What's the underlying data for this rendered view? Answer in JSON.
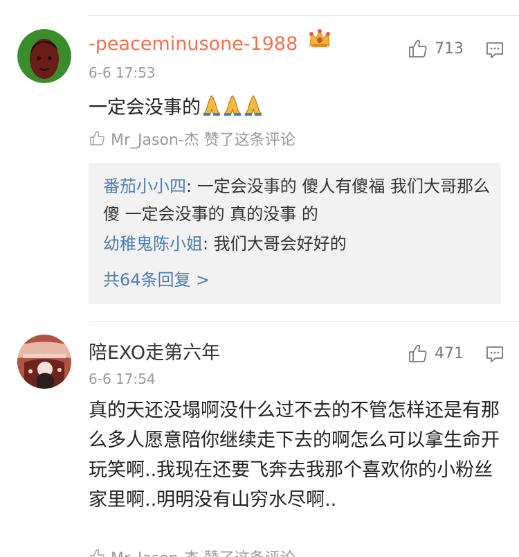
{
  "comments": [
    {
      "username": "-peaceminusone-1988",
      "time": "6-6 17:53",
      "likes": "713",
      "text": "一定会没事的",
      "liked_by": "Mr_Jason-杰 赞了这条评论",
      "replies": [
        {
          "name": "番茄小小四",
          "text": ": 一定会没事的 傻人有傻福 我们大哥那么傻 一定会没事的 真的没事 的"
        },
        {
          "name": "幼稚鬼陈小姐",
          "text": ": 我们大哥会好好的"
        }
      ],
      "more": "共64条回复 >"
    },
    {
      "username": "陪EXO走第六年",
      "time": "6-6 17:54",
      "likes": "471",
      "text": "真的天还没塌啊没什么过不去的不管怎样还是有那么多人愿意陪你继续走下去的啊怎么可以拿生命开玩笑啊..我现在还要飞奔去我那个喜欢你的小粉丝家里啊..明明没有山穷水尽啊..",
      "liked_by": "Mr_Jason-杰 赞了这条评论"
    }
  ]
}
